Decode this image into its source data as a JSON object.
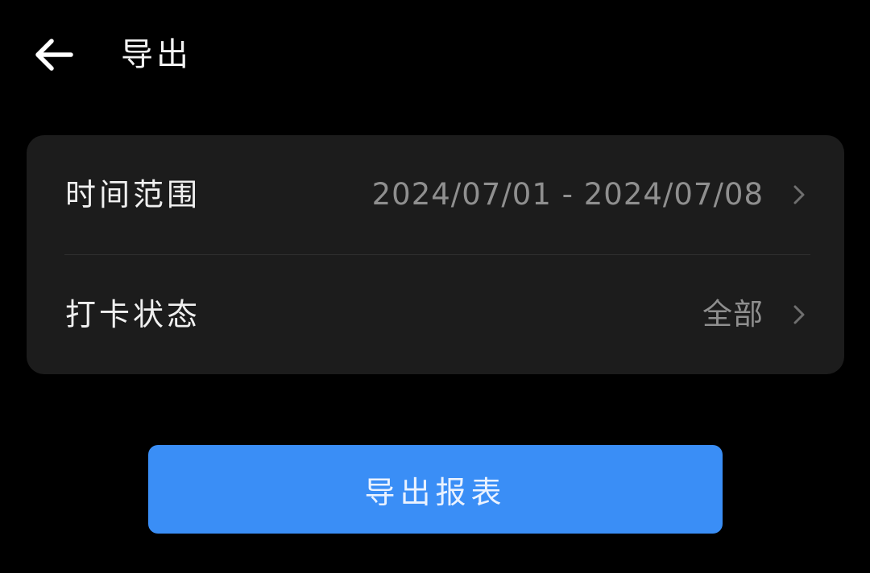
{
  "header": {
    "back_icon": "arrow-left-icon",
    "title": "导出"
  },
  "settings": {
    "rows": [
      {
        "label": "时间范围",
        "value": "2024/07/01 - 2024/07/08",
        "icon": "chevron-right-icon"
      },
      {
        "label": "打卡状态",
        "value": "全部",
        "icon": "chevron-right-icon"
      }
    ]
  },
  "actions": {
    "export_label": "导出报表"
  },
  "colors": {
    "background": "#000000",
    "card": "#1c1c1c",
    "accent": "#3a8ef6",
    "secondary_text": "#8f8f8f"
  }
}
